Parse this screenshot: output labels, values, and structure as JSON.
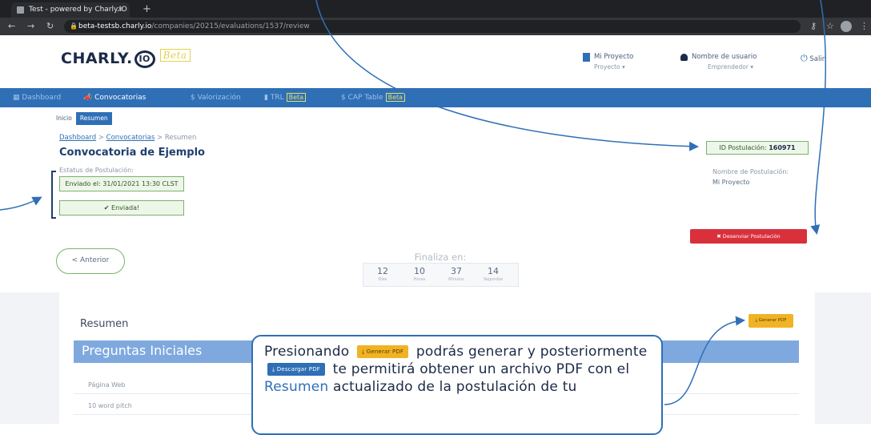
{
  "browser": {
    "tab_title": "Test - powered by Charly.IO",
    "tab_close": "×",
    "new_tab": "+",
    "url_host": "beta-testsb.charly.io",
    "url_path": "/companies/20215/evaluations/1537/review"
  },
  "header": {
    "logo_text": "CHARLY.",
    "logo_badge": "IO",
    "logo_beta": "Beta",
    "project_label": "Mi Proyecto",
    "project_sub": "Proyecto ▾",
    "user_label": "Nombre de usuario",
    "user_sub": "Emprendedor ▾",
    "exit_label": "Salir"
  },
  "nav": {
    "dashboard": "Dashboard",
    "convocatorias": "Convocatorias",
    "valorizacion": "$ Valorización",
    "trl": "TRL",
    "trl_badge": "Beta",
    "cap": "$ CAP Table",
    "cap_badge": "Beta"
  },
  "subtabs": {
    "inicio": "Inicio",
    "resumen": "Resumen"
  },
  "breadcrumb": {
    "l1": "Dashboard",
    "l2": "Convocatorias",
    "l3": "Resumen"
  },
  "page": {
    "title": "Convocatoria de Ejemplo",
    "status_label": "Estatus de Postulación:",
    "sent_on": "Enviado el: 31/01/2021 13:30 CLST",
    "sent_badge": "✔ Enviada!",
    "id_label": "ID Postulación:",
    "id_value": "160971",
    "name_label": "Nombre de Postulación:",
    "name_value": "Mi Proyecto",
    "unsubmit_button": "✖ Desenviar Postulación",
    "prev_button": "< Anterior",
    "finaliza_label": "Finaliza en:",
    "timer": [
      {
        "value": "12",
        "unit": "Días"
      },
      {
        "value": "10",
        "unit": "Horas"
      },
      {
        "value": "37",
        "unit": "Minutos"
      },
      {
        "value": "14",
        "unit": "Segundos"
      }
    ]
  },
  "summary": {
    "title": "Resumen",
    "generate_pdf": "⤓ Generar PDF",
    "section_title": "Preguntas Iniciales",
    "rows": [
      "Página Web",
      "10 word pitch"
    ]
  },
  "callout": {
    "t1": "Presionando",
    "btn1": "⤓ Generar PDF",
    "t2": "podrás generar y posteriormente",
    "btn2": "⤓ Descargar PDF",
    "t3": "te permitirá obtener un archivo PDF con el",
    "link": "Resumen",
    "t4": "actualizado de la postulación de tu"
  }
}
